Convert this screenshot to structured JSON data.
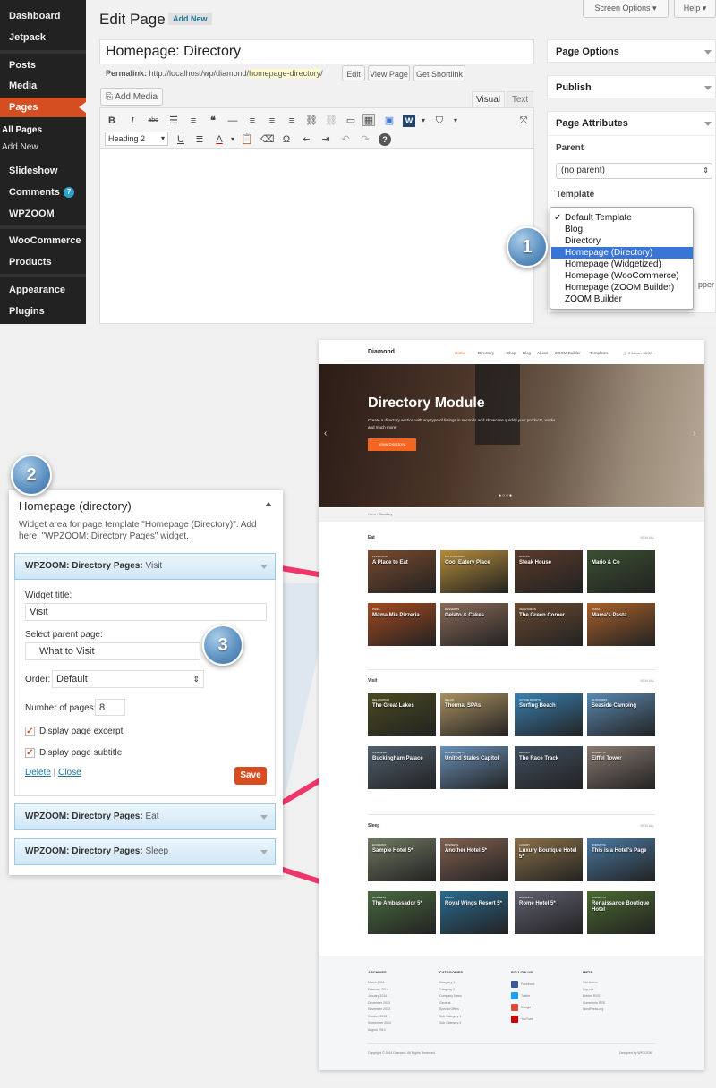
{
  "admin": {
    "sidebar": {
      "items": [
        "Dashboard",
        "Jetpack",
        "Posts",
        "Media",
        "Pages",
        "Slideshow",
        "Comments",
        "WPZOOM",
        "WooCommerce",
        "Products",
        "Appearance",
        "Plugins"
      ],
      "subitems": [
        "All Pages",
        "Add New"
      ],
      "comments_badge": "7"
    },
    "header": {
      "title": "Edit Page",
      "add_new": "Add New",
      "screen_options": "Screen Options",
      "help": "Help"
    },
    "editor": {
      "post_title": "Homepage: Directory",
      "permalink_label": "Permalink:",
      "permalink_base": "http://localhost/wp/diamond/",
      "permalink_slug": "homepage-directory",
      "permalink_end": "/",
      "edit_btn": "Edit",
      "view_btn": "View Page",
      "shortlink_btn": "Get Shortlink",
      "add_media": "Add Media",
      "tab_visual": "Visual",
      "tab_text": "Text",
      "format_select": "Heading 2"
    },
    "panels": {
      "page_options": "Page Options",
      "publish": "Publish",
      "page_attributes": "Page Attributes",
      "parent_label": "Parent",
      "parent_value": "(no parent)",
      "template_label": "Template",
      "truncated": "pper"
    },
    "template_options": [
      "Default Template",
      "Blog",
      "Directory",
      "Homepage (Directory)",
      "Homepage (Widgetized)",
      "Homepage (WooCommerce)",
      "Homepage (ZOOM Builder)",
      "ZOOM Builder"
    ],
    "template_selected_index": 3,
    "template_checked_index": 0
  },
  "steps": [
    "1",
    "2",
    "3"
  ],
  "widget": {
    "title": "Homepage (directory)",
    "description": "Widget area for page template \"Homepage (Directory)\".  Add here: \"WPZOOM: Directory Pages\" widget.",
    "visit_bar_bold": "WPZOOM: Directory Pages:",
    "visit_bar_name": "Visit",
    "title_label": "Widget title:",
    "title_value": "Visit",
    "parent_label": "Select parent page:",
    "parent_value": "What to Visit",
    "order_label": "Order:",
    "order_value": "Default",
    "num_label": "Number of pages:",
    "num_value": "8",
    "excerpt_label": "Display page excerpt",
    "subtitle_label": "Display page subtitle",
    "delete": "Delete",
    "separator": "|",
    "close": "Close",
    "save": "Save",
    "eat_bar_bold": "WPZOOM: Directory Pages:",
    "eat_bar_name": "Eat",
    "sleep_bar_bold": "WPZOOM: Directory Pages:",
    "sleep_bar_name": "Sleep"
  },
  "site": {
    "logo": "Diamond",
    "nav": [
      "Home",
      "Directory",
      "Shop",
      "Blog",
      "About",
      "ZOOM Builder",
      "Templates"
    ],
    "cart": "0 items - $0.00",
    "hero_title": "Directory Module",
    "hero_text": "Create a directory section with any type of listings in seconds and showcase quickly your products, works and much more!",
    "hero_button": "View Directory",
    "breadcrumb": [
      "Home",
      "Directory"
    ],
    "view_all": "VIEW ALL",
    "sections": [
      {
        "title": "Eat",
        "cards": [
          {
            "tag": "Fast Food",
            "title": "A Place to Eat",
            "color": "#7a4a2e"
          },
          {
            "tag": "Delicatessen",
            "title": "Cool Eatery Place",
            "color": "#b58c3a"
          },
          {
            "tag": "Steaks",
            "title": "Steak House",
            "color": "#5a3a2a"
          },
          {
            "tag": "",
            "title": "Mario & Co",
            "color": "#3a5030"
          },
          {
            "tag": "Pizza",
            "title": "Mama Mia Pizzeria",
            "color": "#a44a20"
          },
          {
            "tag": "Desserts",
            "title": "Gelato & Cakes",
            "color": "#8a6a58"
          },
          {
            "tag": "Vegetarian",
            "title": "The Green Corner",
            "color": "#6a4a30"
          },
          {
            "tag": "Pasta",
            "title": "Mama's Pasta",
            "color": "#a8602a"
          }
        ]
      },
      {
        "title": "Visit",
        "cards": [
          {
            "tag": "Relaxation",
            "title": "The Great Lakes",
            "color": "#4a4a20"
          },
          {
            "tag": "Relax",
            "title": "Thermal SPAs",
            "color": "#a89060"
          },
          {
            "tag": "Active Sports",
            "title": "Surfing Beach",
            "color": "#3a80b0"
          },
          {
            "tag": "Outdoors",
            "title": "Seaside Camping",
            "color": "#5a88b0"
          },
          {
            "tag": "Landmark",
            "title": "Buckingham Palace",
            "color": "#506070"
          },
          {
            "tag": "Government",
            "title": "United States Capitol",
            "color": "#6a90b8"
          },
          {
            "tag": "Racing",
            "title": "The Race Track",
            "color": "#405060"
          },
          {
            "tag": "Romantic",
            "title": "Eiffel Tower",
            "color": "#8a7a70"
          }
        ]
      },
      {
        "title": "Sleep",
        "cards": [
          {
            "tag": "Economy",
            "title": "Sample Hotel 5*",
            "color": "#707860"
          },
          {
            "tag": "Business",
            "title": "Another Hotel 5*",
            "color": "#806050"
          },
          {
            "tag": "Luxury",
            "title": "Luxury Boutique Hotel 5*",
            "color": "#8a7048"
          },
          {
            "tag": "Romantic",
            "title": "This is a Hotel's Page",
            "color": "#4a78a0"
          },
          {
            "tag": "Business",
            "title": "The Ambassador 5*",
            "color": "#4a6a40"
          },
          {
            "tag": "Family",
            "title": "Royal Wings Resort 5*",
            "color": "#2a6a90"
          },
          {
            "tag": "Romantic",
            "title": "Rome Hotel 5*",
            "color": "#606070"
          },
          {
            "tag": "Romantic",
            "title": "Renaissance Boutique Hotel",
            "color": "#4a6a30"
          }
        ]
      }
    ],
    "footer": {
      "archives_title": "ARCHIVES",
      "archives": [
        "March 2014",
        "February 2014",
        "January 2014",
        "December 2013",
        "November 2013",
        "October 2013",
        "September 2013",
        "August 2013"
      ],
      "categories_title": "CATEGORIES",
      "categories": [
        "Category 1",
        "Category 2",
        "Company News",
        "General",
        "Special Offers",
        "Sub Category 1",
        "Sub Category 2"
      ],
      "follow_title": "FOLLOW US",
      "follow": [
        "Facebook",
        "Twitter",
        "Google +",
        "YouTube"
      ],
      "meta_title": "META",
      "meta": [
        "Site Admin",
        "Log out",
        "Entries RSS",
        "Comments RSS",
        "WordPress.org"
      ],
      "copyright": "Copyright © 2014 Diamond. All Rights Reserved.",
      "designed": "Designed by WPZOOM"
    }
  },
  "colors": {
    "accent": "#d54e21",
    "selection": "#3875d7",
    "arrow": "#f0356a",
    "widget_bar": "#cfe6f5",
    "hero_button": "#f26522"
  }
}
